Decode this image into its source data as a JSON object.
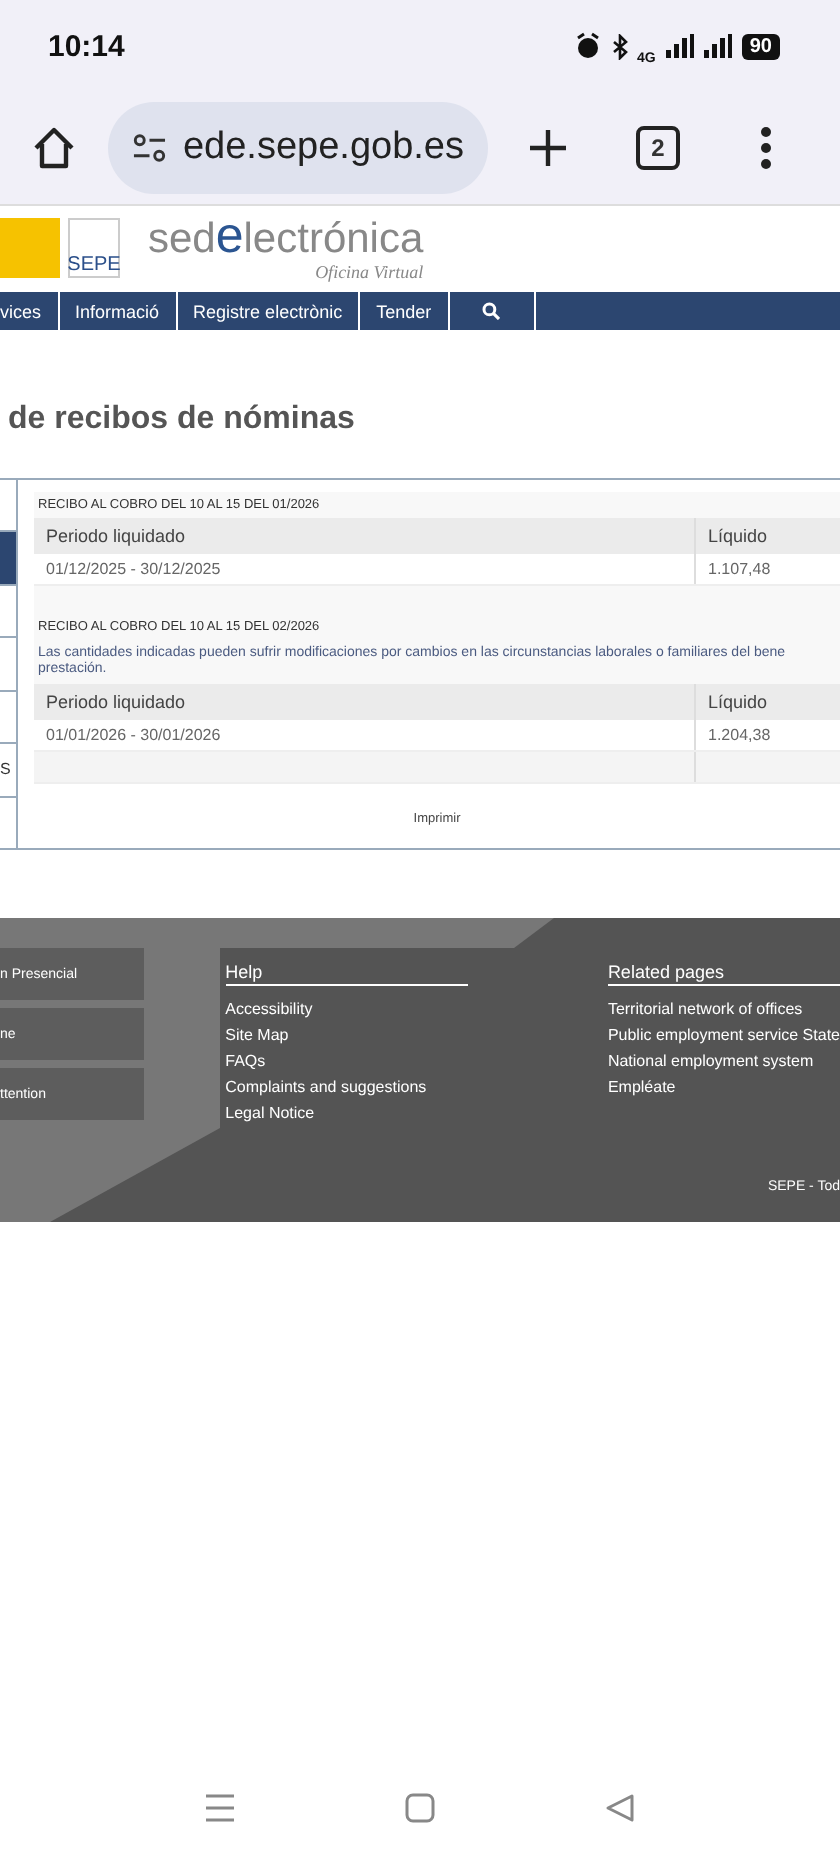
{
  "status_bar": {
    "time": "10:14",
    "network": "4G",
    "battery": "90"
  },
  "browser": {
    "url": "ede.sepe.gob.es",
    "tab_count": "2"
  },
  "header": {
    "logo_text": "SEPE",
    "brand_left": "sed",
    "brand_mark": "e",
    "brand_right": "lectrónica",
    "brand_sub": "Oficina Virtual"
  },
  "nav": [
    {
      "kind": "text",
      "label": "vices"
    },
    {
      "kind": "text",
      "label": "Informació"
    },
    {
      "kind": "text",
      "label": "Registre electrònic"
    },
    {
      "kind": "text",
      "label": "Tender"
    },
    {
      "kind": "search"
    }
  ],
  "page_title": "de recibos de nóminas",
  "sidebar": [
    {
      "selected": false
    },
    {
      "selected": true
    },
    {
      "selected": false
    },
    {
      "selected": false
    },
    {
      "selected": false
    },
    {
      "selected": false,
      "label": "S"
    },
    {
      "selected": false
    }
  ],
  "receipts": [
    {
      "title": "RECIBO AL COBRO DEL 10 AL 15 DEL 01/2026",
      "columns": [
        "Periodo liquidado",
        "Líquido"
      ],
      "rows": [
        [
          "01/12/2025  -  30/12/2025",
          "1.107,48"
        ]
      ],
      "blank_row": false
    },
    {
      "title": "RECIBO AL COBRO DEL 10 AL 15 DEL 02/2026",
      "note": "Las cantidades indicadas pueden sufrir modificaciones por cambios en las circunstancias laborales o familiares del bene prestación.",
      "columns": [
        "Periodo liquidado",
        "Líquido"
      ],
      "rows": [
        [
          "01/01/2026  -  30/01/2026",
          "1.204,38"
        ]
      ],
      "blank_row": true
    }
  ],
  "print_link": "Imprimir",
  "footer": {
    "buttons": [
      "n Presencial",
      "ne",
      "ttention"
    ],
    "help": {
      "title": "Help",
      "links": [
        "Accessibility",
        "Site Map",
        "FAQs",
        "Complaints and suggestions",
        "Legal Notice"
      ]
    },
    "related": {
      "title": "Related pages",
      "links": [
        "Territorial network of offices",
        "Public employment service State",
        "National employment system",
        "Empléate"
      ]
    },
    "copyright": "SEPE - Tod"
  }
}
